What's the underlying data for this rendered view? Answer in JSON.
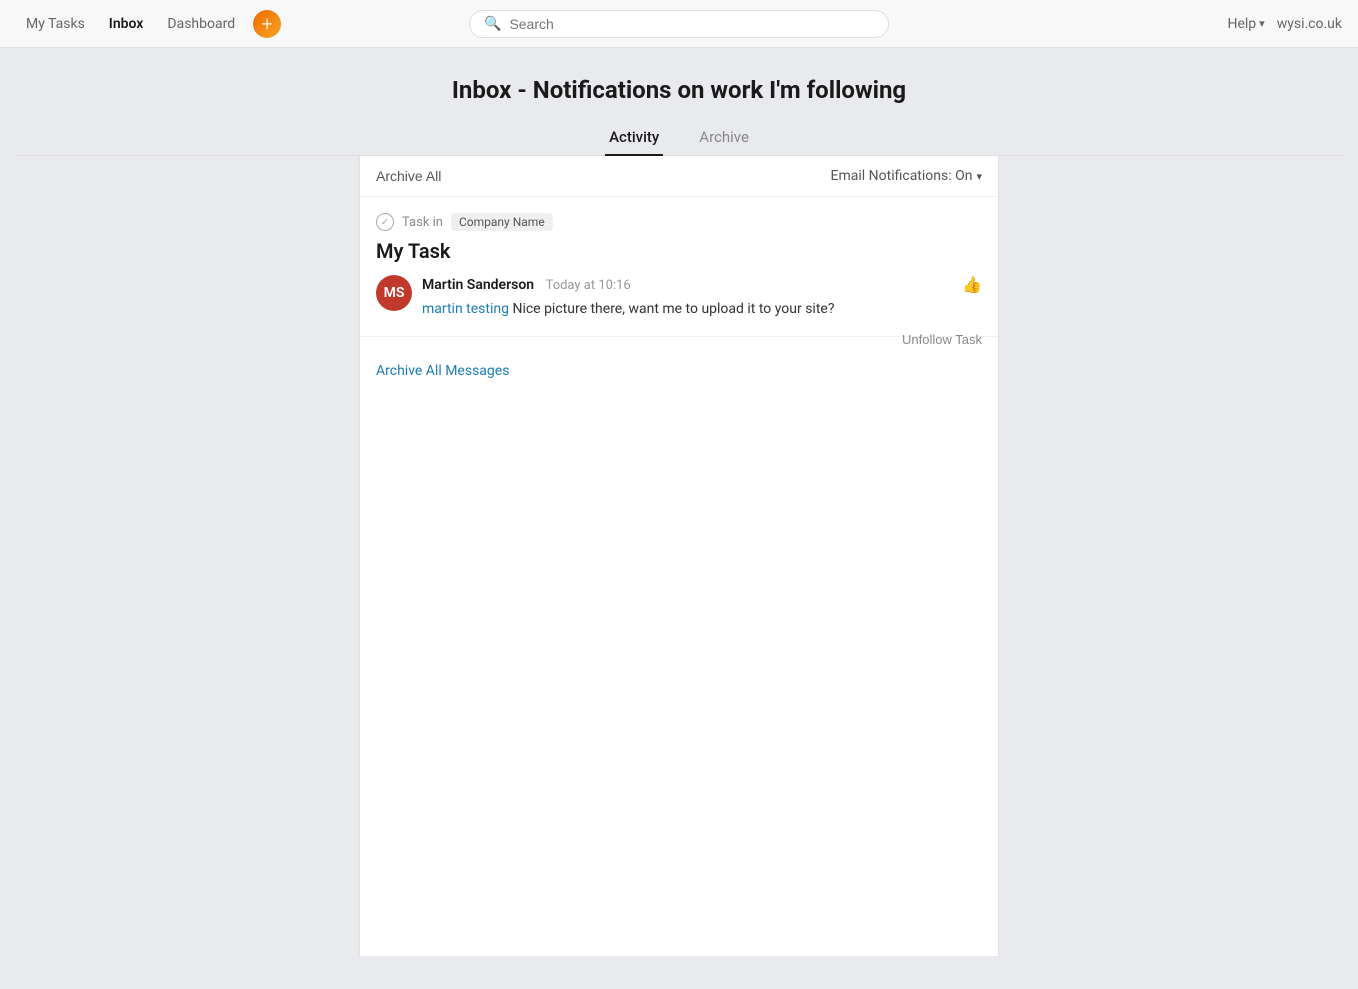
{
  "nav": {
    "my_tasks": "My Tasks",
    "inbox": "Inbox",
    "dashboard": "Dashboard",
    "help": "Help",
    "user": "wysi.co.uk"
  },
  "search": {
    "placeholder": "Search"
  },
  "page": {
    "title": "Inbox - Notifications on work I'm following"
  },
  "tabs": [
    {
      "id": "activity",
      "label": "Activity",
      "active": true
    },
    {
      "id": "archive",
      "label": "Archive",
      "active": false
    }
  ],
  "toolbar": {
    "archive_all": "Archive All",
    "email_notifications": "Email Notifications: On"
  },
  "notification": {
    "task_in": "Task in",
    "project": "Company Name",
    "task_name": "My Task",
    "comment": {
      "author": "Martin Sanderson",
      "timestamp": "Today at 10:16",
      "mention": "martin testing",
      "text": " Nice picture there, want me to upload it to your site?"
    },
    "unfollow": "Unfollow Task",
    "archive_messages": "Archive All Messages"
  }
}
